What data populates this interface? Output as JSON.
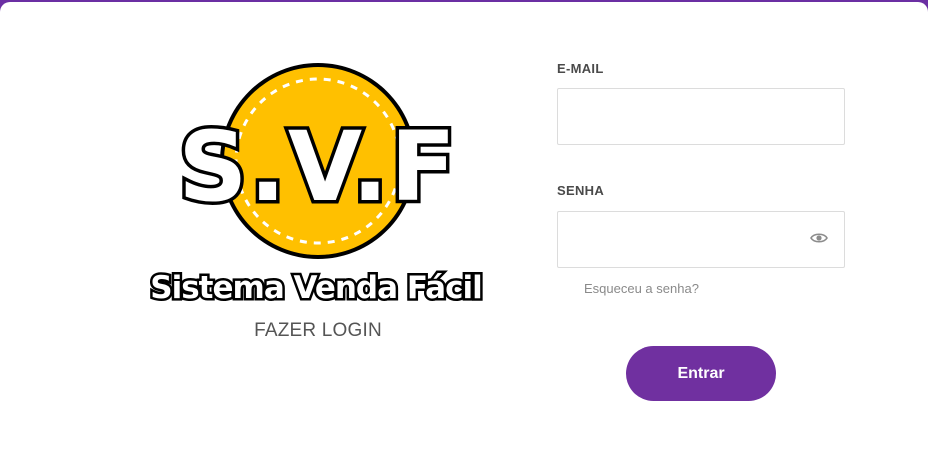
{
  "brand": {
    "logo_letters": "S.V.F",
    "logo_tagline": "Sistema Venda Fácil",
    "logo_coin_color": "#ffc000",
    "accent_color": "#7030a0"
  },
  "login": {
    "title": "FAZER LOGIN",
    "email_label": "E-MAIL",
    "email_value": "",
    "password_label": "SENHA",
    "password_value": "",
    "show_password_icon": "eye-icon",
    "forgot_password": "Esqueceu a senha?",
    "submit_label": "Entrar"
  }
}
